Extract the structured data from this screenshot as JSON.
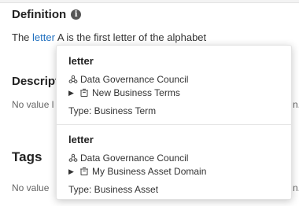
{
  "definition": {
    "title": "Definition",
    "text_before": "The ",
    "link": "letter",
    "text_after": " A is the first letter of the alphabet"
  },
  "description": {
    "title": "Descript",
    "value_start": "No value l",
    "value_end": "n."
  },
  "tags": {
    "title": "Tags",
    "value_start": "No value",
    "value_end": "n."
  },
  "popover": {
    "results": [
      {
        "name": "letter",
        "community": "Data Governance Council",
        "domain": "New Business Terms",
        "type": "Type: Business Term"
      },
      {
        "name": "letter",
        "community": "Data Governance Council",
        "domain": "My Business Asset Domain",
        "type": "Type: Business Asset"
      }
    ]
  }
}
